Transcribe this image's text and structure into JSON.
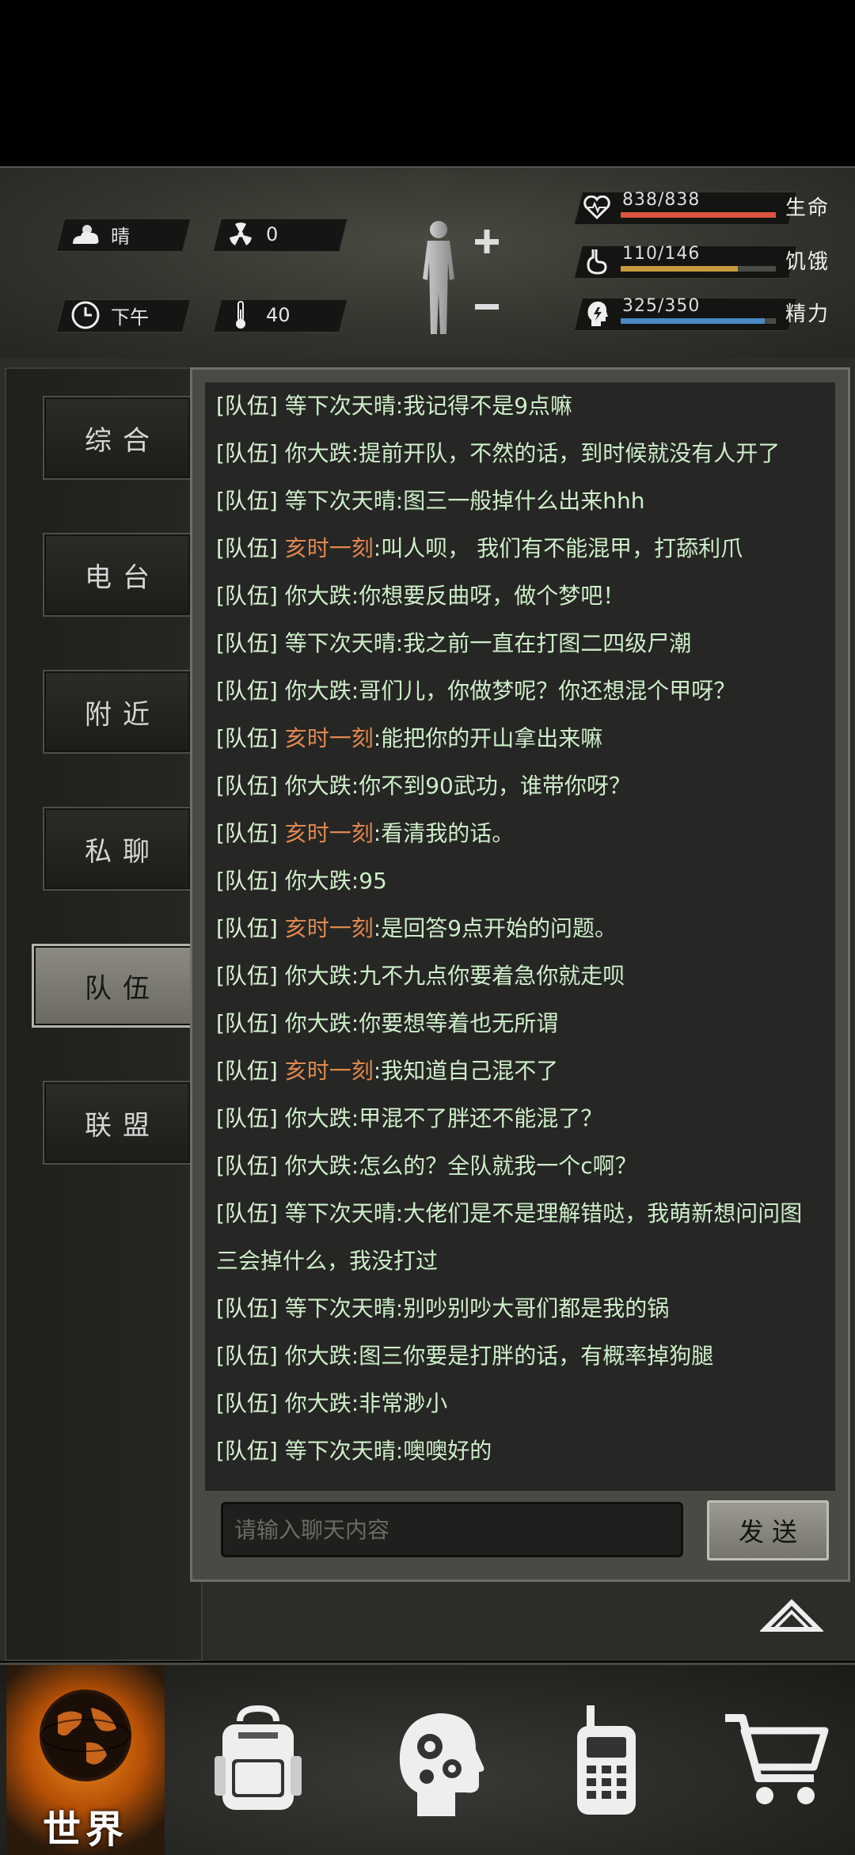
{
  "status": {
    "weather": "晴",
    "radiation": "0",
    "time_of_day": "下午",
    "temperature": "40",
    "stats": [
      {
        "label": "生命",
        "value": "838/838",
        "fraction": 1.0,
        "color": "#d9553f",
        "icon": "heart-icon"
      },
      {
        "label": "饥饿",
        "value": "110/146",
        "fraction": 0.753,
        "color": "#c69a3a",
        "icon": "stomach-icon"
      },
      {
        "label": "精力",
        "value": "325/350",
        "fraction": 0.929,
        "color": "#4a8ac4",
        "icon": "head-energy-icon"
      }
    ]
  },
  "tabs": [
    {
      "label": "综合",
      "active": false
    },
    {
      "label": "电台",
      "active": false
    },
    {
      "label": "附近",
      "active": false
    },
    {
      "label": "私聊",
      "active": false
    },
    {
      "label": "队伍",
      "active": true
    },
    {
      "label": "联盟",
      "active": false
    }
  ],
  "chat": {
    "channel": "[队伍]",
    "messages": [
      {
        "name": "等下次天晴",
        "text": ":我记得不是9点嘛",
        "highlight": false
      },
      {
        "name": "你大跌",
        "text": ":提前开队，不然的话，到时候就没有人开了",
        "highlight": false
      },
      {
        "name": "等下次天晴",
        "text": ":图三一般掉什么出来hhh",
        "highlight": false
      },
      {
        "name": "亥时一刻",
        "text": ":叫人呗， 我们有不能混甲，打舔利爪",
        "highlight": true
      },
      {
        "name": "你大跌",
        "text": ":你想要反曲呀，做个梦吧！",
        "highlight": false
      },
      {
        "name": "等下次天晴",
        "text": ":我之前一直在打图二四级尸潮",
        "highlight": false
      },
      {
        "name": "你大跌",
        "text": ":哥们儿，你做梦呢？你还想混个甲呀？",
        "highlight": false
      },
      {
        "name": "亥时一刻",
        "text": ":能把你的开山拿出来嘛",
        "highlight": true
      },
      {
        "name": "你大跌",
        "text": ":你不到90武功，谁带你呀？",
        "highlight": false
      },
      {
        "name": "亥时一刻",
        "text": ":看清我的话。",
        "highlight": true
      },
      {
        "name": "你大跌",
        "text": ":95",
        "highlight": false
      },
      {
        "name": "亥时一刻",
        "text": ":是回答9点开始的问题。",
        "highlight": true
      },
      {
        "name": "你大跌",
        "text": ":九不九点你要着急你就走呗",
        "highlight": false
      },
      {
        "name": "你大跌",
        "text": ":你要想等着也无所谓",
        "highlight": false
      },
      {
        "name": "亥时一刻",
        "text": ":我知道自己混不了",
        "highlight": true
      },
      {
        "name": "你大跌",
        "text": ":甲混不了胖还不能混了？",
        "highlight": false
      },
      {
        "name": "你大跌",
        "text": ":怎么的？全队就我一个c啊？",
        "highlight": false
      },
      {
        "name": "等下次天晴",
        "text": ":大佬们是不是理解错哒，我萌新想问问图三会掉什么，我没打过",
        "highlight": false
      },
      {
        "name": "等下次天晴",
        "text": ":别吵别吵大哥们都是我的锅",
        "highlight": false
      },
      {
        "name": "你大跌",
        "text": ":图三你要是打胖的话，有概率掉狗腿",
        "highlight": false
      },
      {
        "name": "你大跌",
        "text": ":非常渺小",
        "highlight": false
      },
      {
        "name": "等下次天晴",
        "text": ":噢噢好的",
        "highlight": false
      }
    ],
    "input_placeholder": "请输入聊天内容",
    "send_label": "发送"
  },
  "nav": {
    "world_label": "世界",
    "items": [
      "globe-icon",
      "backpack-icon",
      "head-gears-icon",
      "walkie-talkie-icon",
      "shopping-cart-icon"
    ]
  }
}
